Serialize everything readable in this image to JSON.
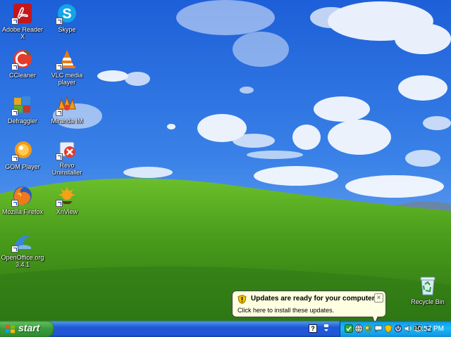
{
  "desktop": {
    "icons": [
      {
        "label": "Adobe Reader\nX",
        "icon": "adobe-reader-icon"
      },
      {
        "label": "Skype",
        "icon": "skype-icon"
      },
      {
        "label": "CCleaner",
        "icon": "ccleaner-icon"
      },
      {
        "label": "VLC media\nplayer",
        "icon": "vlc-icon"
      },
      {
        "label": "Defraggler",
        "icon": "defraggler-icon"
      },
      {
        "label": "Miranda IM",
        "icon": "miranda-icon"
      },
      {
        "label": "GOM Player",
        "icon": "gom-player-icon"
      },
      {
        "label": "Revo\nUninstaller",
        "icon": "revo-uninstaller-icon"
      },
      {
        "label": "Mozilla Firefox",
        "icon": "firefox-icon"
      },
      {
        "label": "XnView",
        "icon": "xnview-icon"
      },
      {
        "label": "OpenOffice.org\n3.4.1",
        "icon": "openoffice-icon"
      },
      {
        "label": "Recycle Bin",
        "icon": "recycle-bin-icon"
      }
    ]
  },
  "balloon": {
    "title": "Updates are ready for your computer",
    "body": "Click here to install these updates.",
    "close": "×"
  },
  "taskbar": {
    "start_label": "start",
    "help_glyph": "?",
    "clock": "10:52 PM"
  },
  "colors": {
    "sky": "#2a6fe0",
    "grass": "#4a9a1e",
    "taskbar": "#2157d7",
    "start": "#3a9a3a",
    "tray": "#139ee9",
    "balloon": "#ffffe1"
  }
}
